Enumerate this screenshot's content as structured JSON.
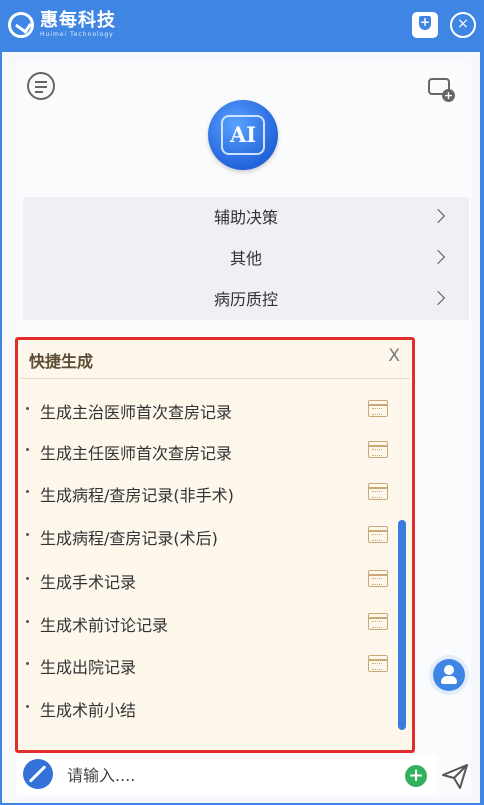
{
  "header": {
    "logo_cn": "惠每科技",
    "logo_en": "Huimei Technology",
    "shield_icon": "shield-plus-icon",
    "close_icon": "close-icon"
  },
  "toolbar": {
    "menu_icon": "menu-list-icon",
    "new_chat_icon": "message-add-icon"
  },
  "assistant": {
    "badge_label": "AI"
  },
  "nav": {
    "items": [
      {
        "label": "辅助决策"
      },
      {
        "label": "其他"
      },
      {
        "label": "病历质控"
      }
    ]
  },
  "quick": {
    "title": "快捷生成",
    "close_label": "X",
    "items": [
      {
        "label": "生成主治医师首次查房记录"
      },
      {
        "label": "生成主任医师首次查房记录"
      },
      {
        "label": "生成病程/查房记录(非手术)"
      },
      {
        "label": "生成病程/查房记录(术后)"
      },
      {
        "label": "生成手术记录"
      },
      {
        "label": "生成术前讨论记录"
      },
      {
        "label": "生成出院记录"
      },
      {
        "label": "生成术前小结"
      }
    ]
  },
  "input": {
    "placeholder": "请输入....",
    "value": ""
  },
  "colors": {
    "brand": "#3f86e4",
    "highlight_border": "#e32d2d",
    "panel_bg": "#fdf7ec",
    "add_green": "#34b15d"
  }
}
